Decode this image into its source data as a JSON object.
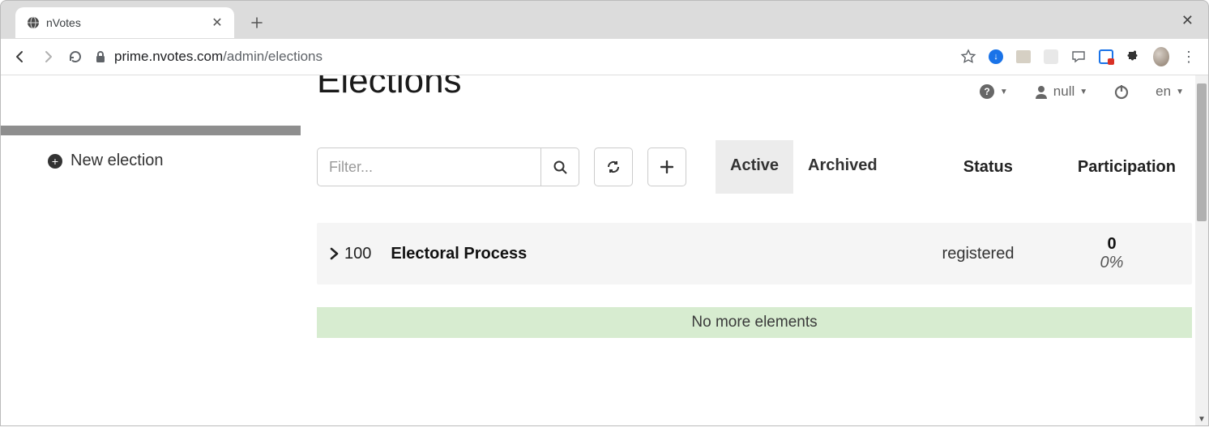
{
  "browser": {
    "tab_title": "nVotes",
    "url_host": "prime.nvotes.com",
    "url_path": "/admin/elections"
  },
  "header": {
    "user_label": "null",
    "lang_label": "en"
  },
  "sidebar": {
    "new_election_label": "New election"
  },
  "main": {
    "title": "Elections",
    "filter_placeholder": "Filter...",
    "tab_active": "Active",
    "tab_archived": "Archived",
    "col_status": "Status",
    "col_participation": "Participation"
  },
  "row": {
    "id": "100",
    "name": "Electoral Process",
    "status": "registered",
    "count": "0",
    "pct": "0%"
  },
  "footer_msg": "No more elements"
}
